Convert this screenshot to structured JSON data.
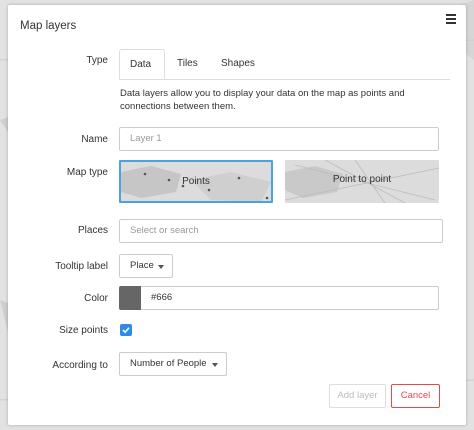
{
  "panel": {
    "title": "Map layers"
  },
  "labels": {
    "type": "Type",
    "name": "Name",
    "map_type": "Map type",
    "places": "Places",
    "tooltip_label": "Tooltip label",
    "color": "Color",
    "size_points": "Size points",
    "according_to": "According to"
  },
  "tabs": [
    {
      "label": "Data",
      "active": true
    },
    {
      "label": "Tiles",
      "active": false
    },
    {
      "label": "Shapes",
      "active": false
    }
  ],
  "description": "Data layers allow you to display your data on the map as points and connections between them.",
  "fields": {
    "name_placeholder": "Layer 1",
    "places_placeholder": "Select or search",
    "tooltip_value": "Place",
    "color_value": "#666",
    "size_points_checked": true,
    "according_to_value": "Number of People"
  },
  "map_types": [
    {
      "label": "Points",
      "selected": true
    },
    {
      "label": "Point to point",
      "selected": false
    }
  ],
  "buttons": {
    "add_layer": "Add layer",
    "cancel": "Cancel"
  },
  "colors": {
    "accent": "#4aa3df",
    "checkbox": "#2e8ce6",
    "cancel": "#e24b4b",
    "swatch": "#666666"
  }
}
